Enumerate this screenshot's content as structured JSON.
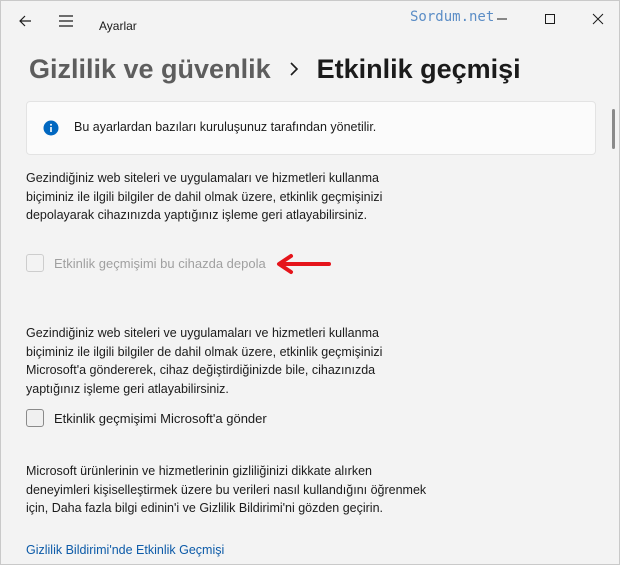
{
  "window": {
    "title": "Ayarlar",
    "watermark": "Sordum.net"
  },
  "breadcrumb": {
    "parent": "Gizlilik ve güvenlik",
    "current": "Etkinlik geçmişi"
  },
  "info": {
    "text": "Bu ayarlardan bazıları kuruluşunuz tarafından yönetilir."
  },
  "section1": {
    "lines": [
      "Gezindiğiniz web siteleri ve uygulamaları ve hizmetleri kullanma",
      "biçiminiz ile ilgili bilgiler de dahil olmak üzere, etkinlik geçmişinizi",
      "depolayarak cihazınızda yaptığınız işleme geri atlayabilirsiniz."
    ]
  },
  "checkbox1": {
    "label": "Etkinlik geçmişimi bu cihazda depola",
    "checked": false,
    "disabled": true
  },
  "section2": {
    "lines": [
      "Gezindiğiniz web siteleri ve uygulamaları ve hizmetleri kullanma",
      "biçiminiz ile ilgili bilgiler de dahil olmak üzere, etkinlik geçmişinizi",
      "Microsoft'a göndererek, cihaz değiştirdiğinizde bile, cihazınızda",
      "yaptığınız işleme geri atlayabilirsiniz."
    ]
  },
  "checkbox2": {
    "label": "Etkinlik geçmişimi Microsoft'a gönder",
    "checked": false,
    "disabled": false
  },
  "section3": {
    "lines": [
      "Microsoft ürünlerinin ve hizmetlerinin gizliliğinizi dikkate alırken",
      "deneyimleri kişiselleştirmek üzere bu verileri nasıl kullandığını öğrenmek",
      "için, Daha fazla bilgi edinin'i ve Gizlilik Bildirimi'ni gözden geçirin."
    ]
  },
  "link": {
    "text": "Gizlilik Bildirimi'nde Etkinlik Geçmişi"
  },
  "colors": {
    "accent": "#0d5ba8",
    "annotation_arrow": "#e5141b",
    "info_icon": "#0067c0"
  }
}
